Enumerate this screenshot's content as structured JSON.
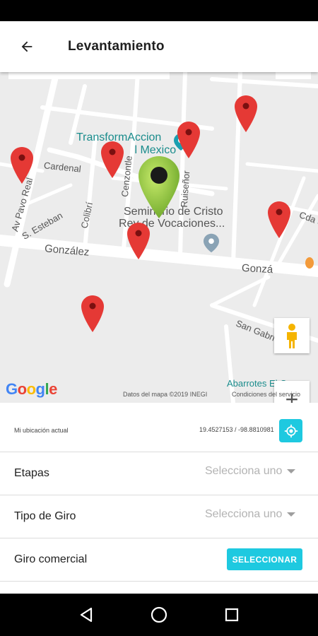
{
  "app_bar": {
    "title": "Levantamiento",
    "back_icon": "arrow-left-icon"
  },
  "map": {
    "streets": [
      "Cardenal",
      "S. Esteban",
      "Colibrí",
      "Cenzontle",
      "Ruiseñor",
      "Av Pavo Real",
      "González",
      "Gonzá",
      "San Gabriel",
      "Cda S"
    ],
    "poi": {
      "line1": "TransformAccion",
      "line2": "G",
      "line2b": "l Mexico"
    },
    "poi2": {
      "line1": "Seminario de Cristo",
      "line2": "Rey de Vocaciones..."
    },
    "store": "Abarrotes El Cor",
    "google_logo": [
      "G",
      "o",
      "o",
      "g",
      "l",
      "e"
    ],
    "footer_data": "Datos del mapa ©2019 INEGI",
    "footer_terms": "Condiciones del servicio",
    "zoom_in": "+",
    "zoom_out": "−",
    "colors": {
      "pin_red": "#e53935",
      "pin_green": "#8bc34a"
    }
  },
  "location": {
    "label": "Mi ubicación actual",
    "coords": "19.4527153 / -98.8810981",
    "button_icon": "my-location-icon"
  },
  "fields": {
    "etapas": {
      "label": "Etapas",
      "placeholder": "Selecciona uno"
    },
    "tipo_giro": {
      "label": "Tipo de Giro",
      "placeholder": "Selecciona uno"
    },
    "giro_comercial": {
      "label": "Giro comercial",
      "button": "SELECCIONAR"
    }
  },
  "accent": "#1ec9e0"
}
